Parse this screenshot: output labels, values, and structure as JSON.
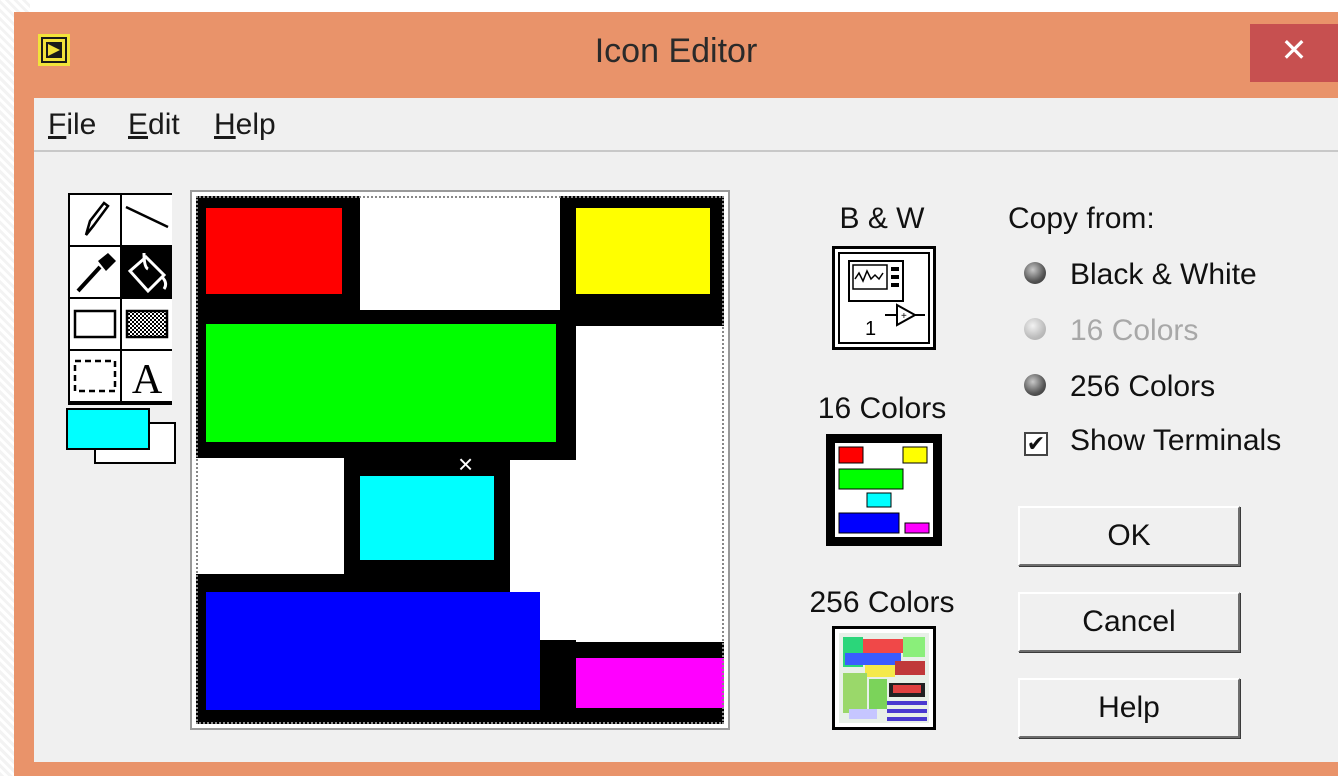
{
  "window": {
    "title": "Icon Editor",
    "close_glyph": "✕"
  },
  "menu": {
    "file": {
      "mnemonic": "F",
      "rest": "ile"
    },
    "edit": {
      "mnemonic": "E",
      "rest": "dit"
    },
    "help": {
      "mnemonic": "H",
      "rest": "elp"
    }
  },
  "tools": [
    "pencil-icon",
    "line-icon",
    "dropper-icon",
    "fill-bucket-icon",
    "rectangle-icon",
    "filled-rectangle-icon",
    "select-icon",
    "text-icon"
  ],
  "colors": {
    "foreground": "#00ffff",
    "background": "#ffffff"
  },
  "canvas": {
    "blocks": [
      {
        "color": "#ff0000"
      },
      {
        "color": "#ffffff"
      },
      {
        "color": "#ffff00"
      },
      {
        "color": "#00ff00"
      },
      {
        "color": "#ffffff"
      },
      {
        "color": "#ffffff"
      },
      {
        "color": "#00ffff"
      },
      {
        "color": "#ffffff"
      },
      {
        "color": "#0000ff"
      },
      {
        "color": "#ff00ff"
      }
    ]
  },
  "previews": {
    "bw": {
      "label": "B & W",
      "terminal_number": "1"
    },
    "c16": {
      "label": "16 Colors"
    },
    "c256": {
      "label": "256 Colors"
    }
  },
  "copy_from": {
    "label": "Copy from:",
    "options": [
      {
        "label": "Black & White",
        "enabled": true
      },
      {
        "label": "16 Colors",
        "enabled": false
      },
      {
        "label": "256 Colors",
        "enabled": true
      }
    ],
    "show_terminals": {
      "label": "Show Terminals",
      "checked": true,
      "check_glyph": "✔"
    }
  },
  "buttons": {
    "ok": "OK",
    "cancel": "Cancel",
    "help": "Help"
  }
}
